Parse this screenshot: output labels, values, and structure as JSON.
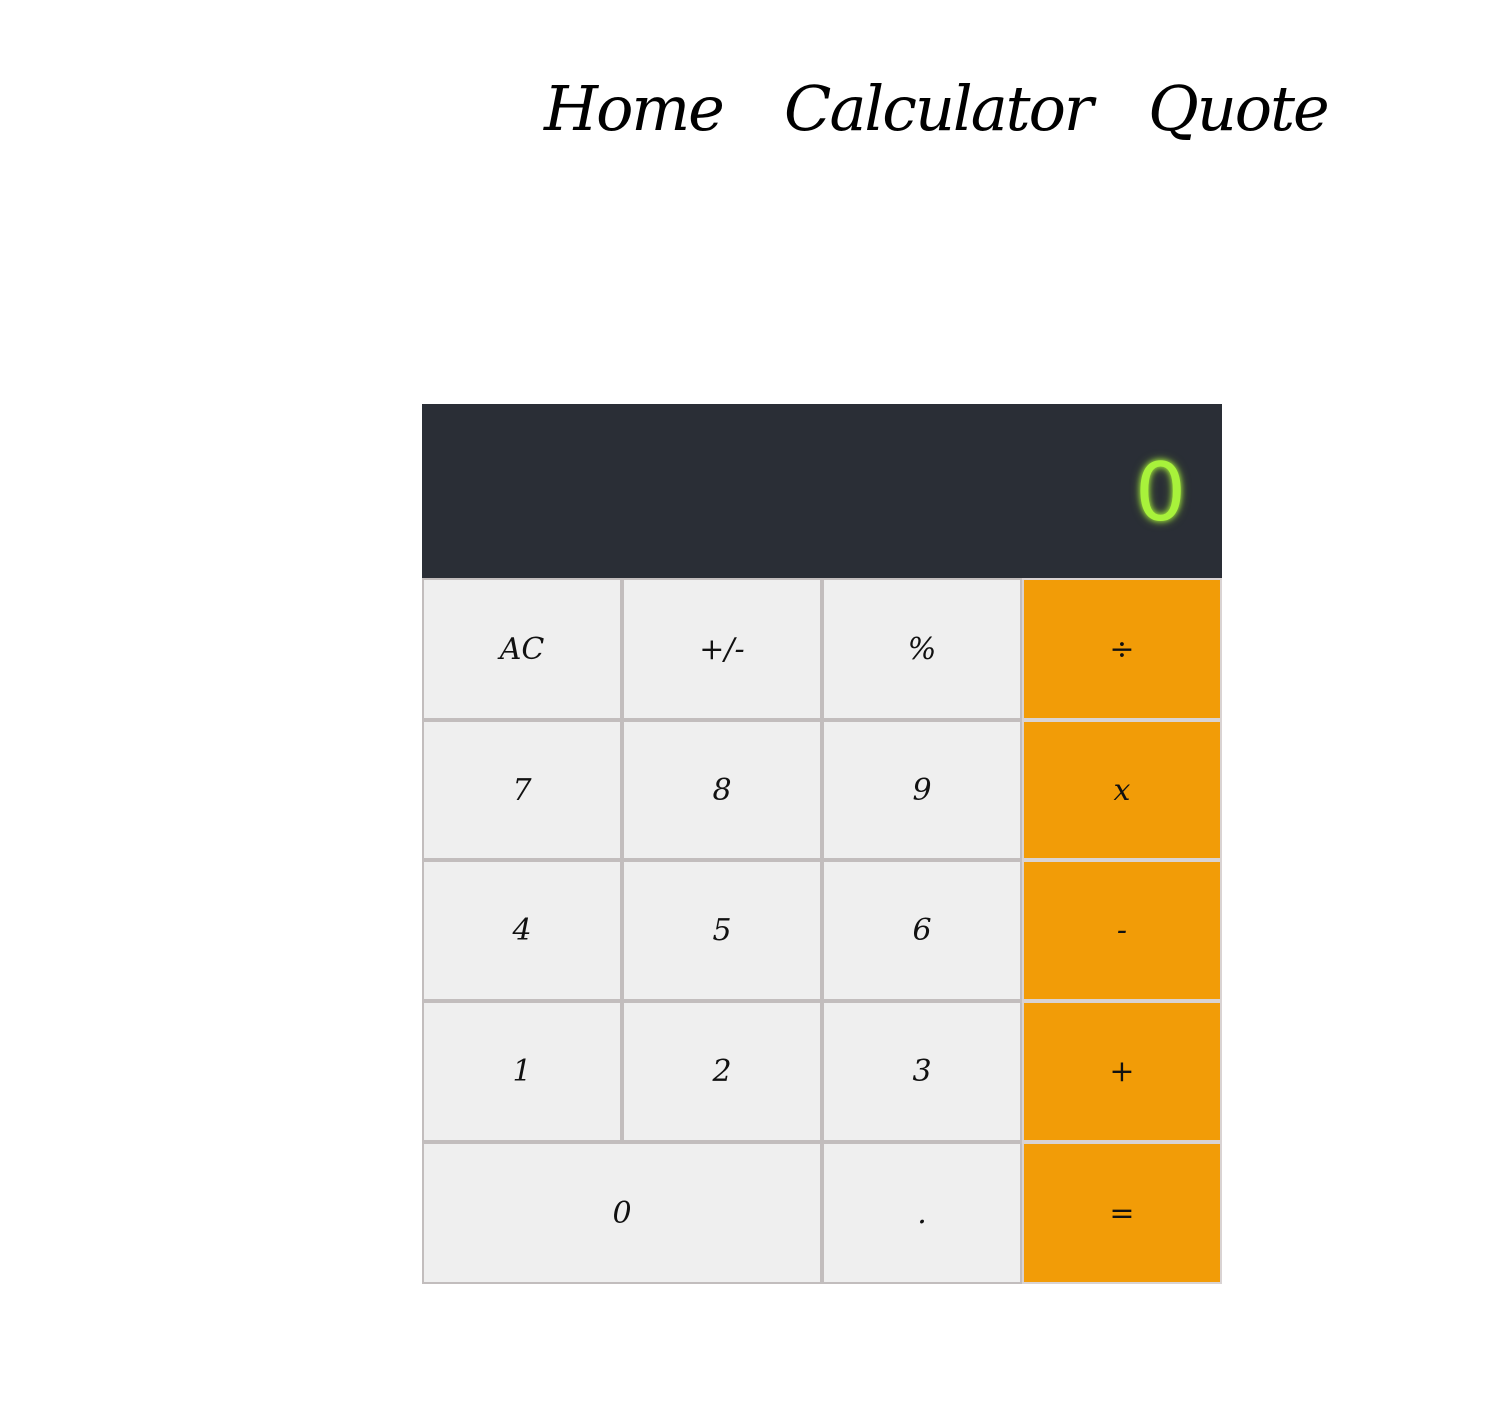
{
  "nav": {
    "home": "Home",
    "calculator": "Calculator",
    "quote": "Quote"
  },
  "display": {
    "value": "0",
    "color": "#a8f23b",
    "background": "#2a2e36"
  },
  "keys": {
    "row1": [
      "AC",
      "+/-",
      "%",
      "÷"
    ],
    "row2": [
      "7",
      "8",
      "9",
      "x"
    ],
    "row3": [
      "4",
      "5",
      "6",
      "-"
    ],
    "row4": [
      "1",
      "2",
      "3",
      "+"
    ],
    "row5": [
      "0",
      ".",
      "="
    ]
  },
  "colors": {
    "operator": "#f29c07",
    "key": "#efefef",
    "key_border": "#c2bdbd"
  }
}
